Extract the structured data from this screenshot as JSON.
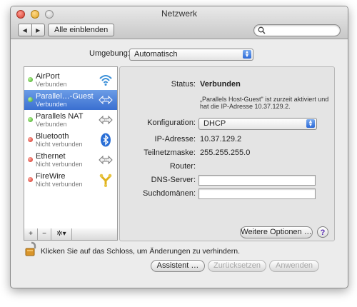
{
  "window": {
    "title": "Netzwerk"
  },
  "toolbar": {
    "back_icon": "◀",
    "forward_icon": "▶",
    "show_all_label": "Alle einblenden",
    "search_value": "",
    "search_icon": "magnifier"
  },
  "location": {
    "label": "Umgebung:",
    "value": "Automatisch"
  },
  "services": [
    {
      "name": "AirPort",
      "status": "Verbunden",
      "status_color": "green",
      "icon": "wifi-icon"
    },
    {
      "name": "Parallel…-Guest",
      "status": "Verbunden",
      "status_color": "green",
      "icon": "ethernet-arrows-icon",
      "selected": true
    },
    {
      "name": "Parallels NAT",
      "status": "Verbunden",
      "status_color": "green",
      "icon": "ethernet-arrows-icon"
    },
    {
      "name": "Bluetooth",
      "status": "Nicht verbunden",
      "status_color": "red",
      "icon": "bluetooth-icon"
    },
    {
      "name": "Ethernet",
      "status": "Nicht verbunden",
      "status_color": "red",
      "icon": "ethernet-arrows-icon"
    },
    {
      "name": "FireWire",
      "status": "Nicht verbunden",
      "status_color": "red",
      "icon": "firewire-icon"
    }
  ],
  "sidebar_toolbar": {
    "add": "+",
    "remove": "−",
    "action": "✲▾"
  },
  "detail": {
    "status_label": "Status:",
    "status_value": "Verbunden",
    "status_note": "„Parallels Host-Guest\" ist zurzeit aktiviert und hat die IP-Adresse 10.37.129.2.",
    "config_label": "Konfiguration:",
    "config_value": "DHCP",
    "ip_label": "IP-Adresse:",
    "ip_value": "10.37.129.2",
    "mask_label": "Teilnetzmaske:",
    "mask_value": "255.255.255.0",
    "router_label": "Router:",
    "router_value": "",
    "dns_label": "DNS-Server:",
    "dns_value": "",
    "search_domains_label": "Suchdomänen:",
    "search_domains_value": "",
    "advanced_button": "Weitere Optionen …",
    "help_button": "?"
  },
  "footer": {
    "lock_text": "Klicken Sie auf das Schloss, um Änderungen zu verhindern.",
    "assistant_button": "Assistent …",
    "revert_button": "Zurücksetzen",
    "apply_button": "Anwenden"
  },
  "colors": {
    "selection": "#3a6fd0",
    "connected": "#3aa31c",
    "disconnected": "#d0281a",
    "help_glyph": "#5b2fb3"
  }
}
